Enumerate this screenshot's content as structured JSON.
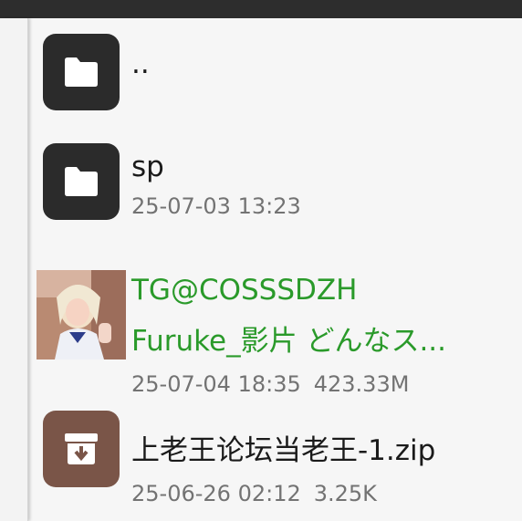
{
  "colors": {
    "top_bar": "#2d2d2d",
    "folder_icon_bg": "#2b2b2b",
    "archive_icon_bg": "#7a5548",
    "media_name_text": "#2a9a2a",
    "meta_text": "#737373"
  },
  "files": [
    {
      "icon": "folder-icon",
      "name": "..",
      "date": "",
      "size": ""
    },
    {
      "icon": "folder-icon",
      "name": "sp",
      "date": "25-07-03 13:23",
      "size": ""
    },
    {
      "icon": "video-thumbnail",
      "name_line1": "TG@COSSSDZH",
      "name_line2": "Furuke_影片 どんなス...",
      "date": "25-07-04 18:35",
      "size": "423.33M"
    },
    {
      "icon": "archive-icon",
      "name": "上老王论坛当老王-1.zip",
      "date": "25-06-26 02:12",
      "size": "3.25K"
    }
  ]
}
